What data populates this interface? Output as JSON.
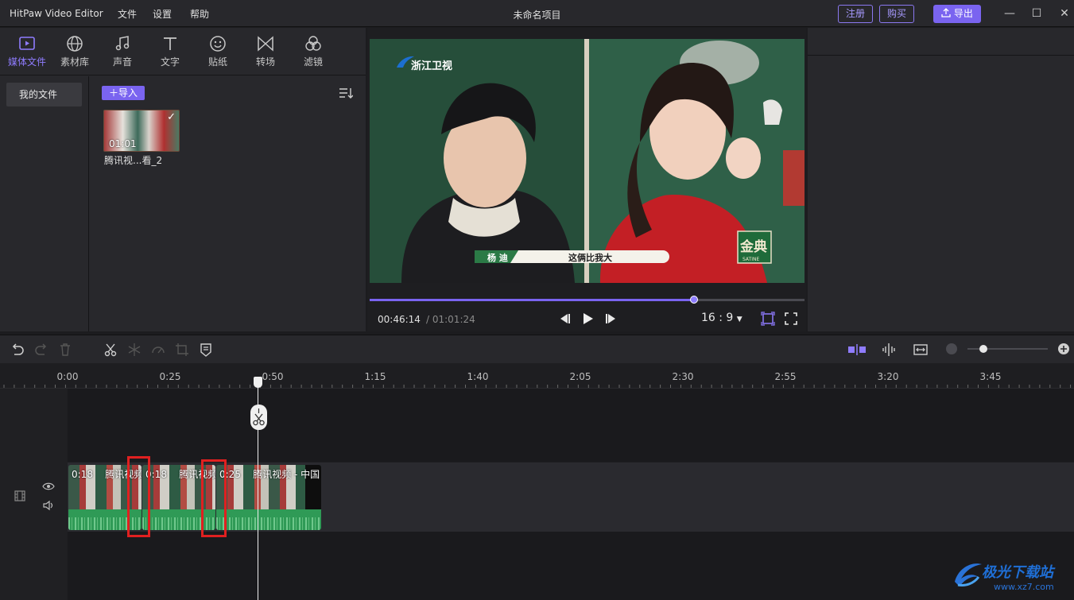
{
  "app": {
    "name": "HitPaw Video Editor",
    "menus": [
      "文件",
      "设置",
      "帮助"
    ],
    "project_title": "未命名项目",
    "register_label": "注册",
    "buy_label": "购买",
    "export_label": "导出"
  },
  "media_tabs": [
    {
      "label": "媒体文件",
      "icon": "media-file-icon",
      "active": true
    },
    {
      "label": "素材库",
      "icon": "globe-icon"
    },
    {
      "label": "声音",
      "icon": "music-note-icon"
    },
    {
      "label": "文字",
      "icon": "text-icon"
    },
    {
      "label": "贴纸",
      "icon": "smiley-icon"
    },
    {
      "label": "转场",
      "icon": "transition-icon"
    },
    {
      "label": "滤镜",
      "icon": "filter-icon"
    }
  ],
  "sidebar": {
    "my_files": "我的文件"
  },
  "library": {
    "import_label": "导入",
    "items": [
      {
        "name": "腾讯视...看_2",
        "duration": "01:01"
      }
    ]
  },
  "preview": {
    "current_time": "00:46:14",
    "total_time": "/ 01:01:24",
    "progress": 0.745,
    "aspect_ratio": "16 : 9",
    "overlay": {
      "channel": "浙江卫视",
      "name_tag": "杨 迪",
      "caption": "这俩比我大",
      "brand": "金典",
      "brand_sub": "SATINE"
    }
  },
  "timeline": {
    "ruler": [
      "0:00",
      "0:25",
      "0:50",
      "1:15",
      "1:40",
      "2:05",
      "2:30",
      "2:55",
      "3:20",
      "3:45"
    ],
    "zoom_level": 0.2,
    "clips": [
      {
        "duration": "0:18",
        "title": "腾讯视频"
      },
      {
        "duration": "0:18",
        "title": "腾讯视频"
      },
      {
        "duration": "0:25",
        "title": "腾讯视频 - 中国"
      }
    ]
  },
  "watermark": {
    "text": "极光下载站",
    "url": "www.xz7.com"
  },
  "colors": {
    "accent": "#7a64f0",
    "highlight": "#e02020",
    "waveform": "#2f9a56"
  }
}
